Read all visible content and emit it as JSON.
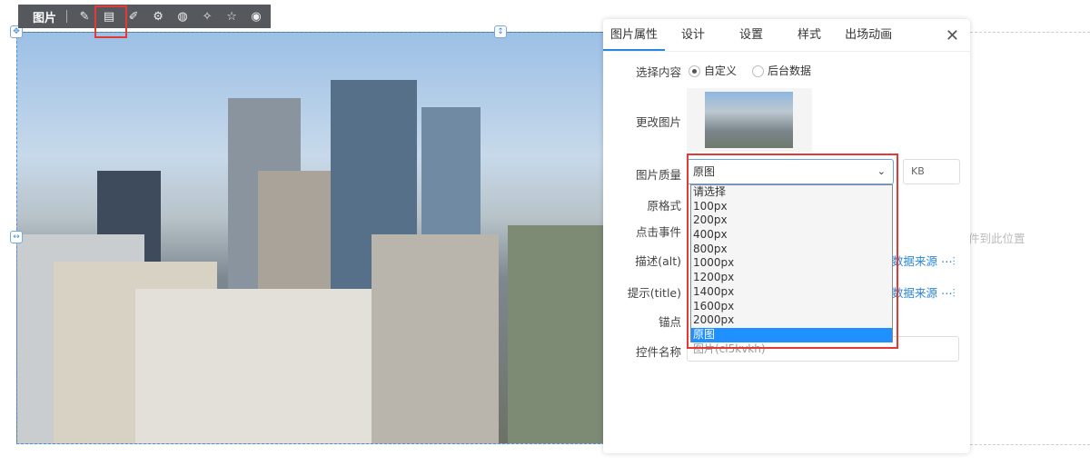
{
  "toolbar": {
    "title": "图片",
    "icons": [
      "edit-icon",
      "image-settings-icon",
      "link-edit-icon",
      "gear-icon",
      "palette-icon",
      "magic-wand-icon",
      "star-icon",
      "eye-icon"
    ]
  },
  "panel": {
    "tabs": [
      "图片属性",
      "设计",
      "设置",
      "样式",
      "出场动画"
    ],
    "close": "✕",
    "select_content": {
      "label": "选择内容",
      "options": [
        "自定义",
        "后台数据"
      ],
      "selected": "自定义"
    },
    "change_image": {
      "label": "更改图片"
    },
    "quality": {
      "label": "图片质量",
      "value": "原图",
      "unit_placeholder": "KB",
      "options": [
        "请选择",
        "100px",
        "200px",
        "400px",
        "800px",
        "1000px",
        "1200px",
        "1400px",
        "1600px",
        "2000px",
        "原图"
      ]
    },
    "original_format": {
      "label": "原格式"
    },
    "click_event": {
      "label": "点击事件"
    },
    "alt": {
      "label": "描述(alt)",
      "link": "数据来源"
    },
    "title": {
      "label": "提示(title)",
      "link": "数据来源"
    },
    "anchor": {
      "label": "锚点"
    },
    "control_name": {
      "label": "控件名称",
      "value": "图片(cl5kvkh)"
    }
  },
  "drop_hint": "件到此位置"
}
